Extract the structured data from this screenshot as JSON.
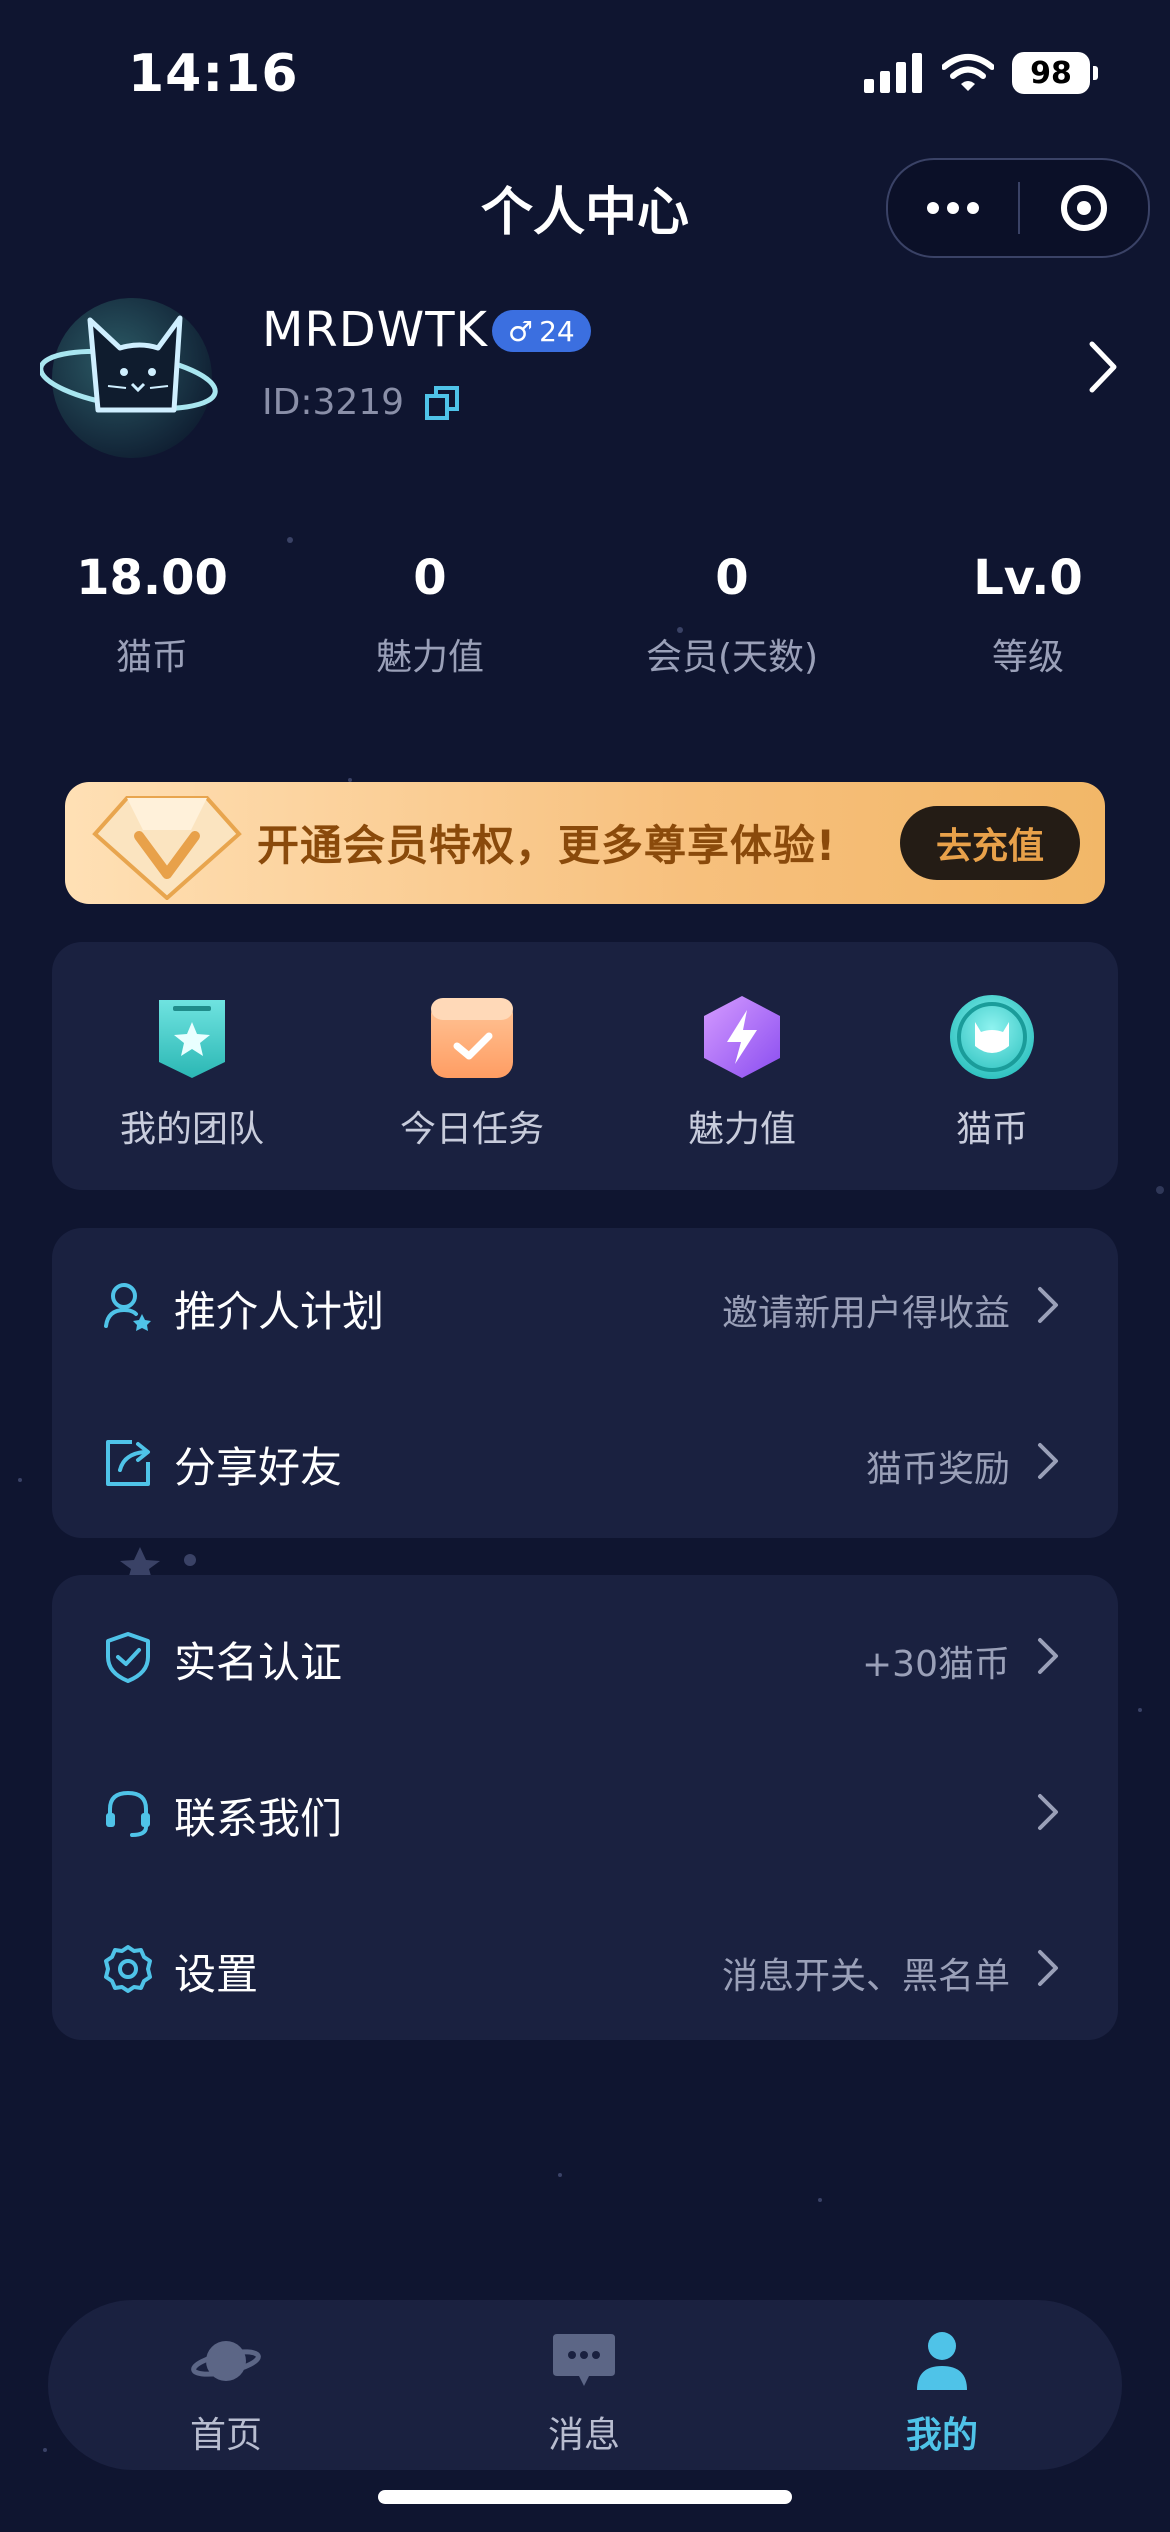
{
  "status": {
    "time": "14:16",
    "battery": "98"
  },
  "nav": {
    "title": "个人中心"
  },
  "profile": {
    "username": "MRDWTK",
    "gender_symbol": "♂",
    "age": "24",
    "user_id": "ID:3219"
  },
  "stats": [
    {
      "value": "18.00",
      "label": "猫币"
    },
    {
      "value": "0",
      "label": "魅力值"
    },
    {
      "value": "0",
      "label": "会员(天数)"
    },
    {
      "value": "Lv.0",
      "label": "等级"
    }
  ],
  "vip": {
    "text": "开通会员特权，更多尊享体验!",
    "button": "去充值"
  },
  "quick": [
    {
      "label": "我的团队",
      "icon": "team-badge-icon"
    },
    {
      "label": "今日任务",
      "icon": "task-icon"
    },
    {
      "label": "魅力值",
      "icon": "charm-icon"
    },
    {
      "label": "猫币",
      "icon": "cat-coin-icon"
    }
  ],
  "menu1": [
    {
      "label": "推介人计划",
      "hint": "邀请新用户得收益",
      "icon": "referral-user-icon"
    },
    {
      "label": "分享好友",
      "hint": "猫币奖励",
      "icon": "share-icon"
    }
  ],
  "menu2": [
    {
      "label": "实名认证",
      "hint": "+30猫币",
      "icon": "shield-check-icon"
    },
    {
      "label": "联系我们",
      "hint": "",
      "icon": "headset-icon"
    },
    {
      "label": "设置",
      "hint": "消息开关、黑名单",
      "icon": "gear-icon"
    }
  ],
  "tabs": [
    {
      "label": "首页",
      "icon": "planet-icon"
    },
    {
      "label": "消息",
      "icon": "chat-icon"
    },
    {
      "label": "我的",
      "icon": "person-icon"
    }
  ],
  "colors": {
    "background": "#0f1530",
    "card": "#1a2140",
    "accent": "#4fc3e8",
    "vip_text": "#8a4a0b"
  }
}
